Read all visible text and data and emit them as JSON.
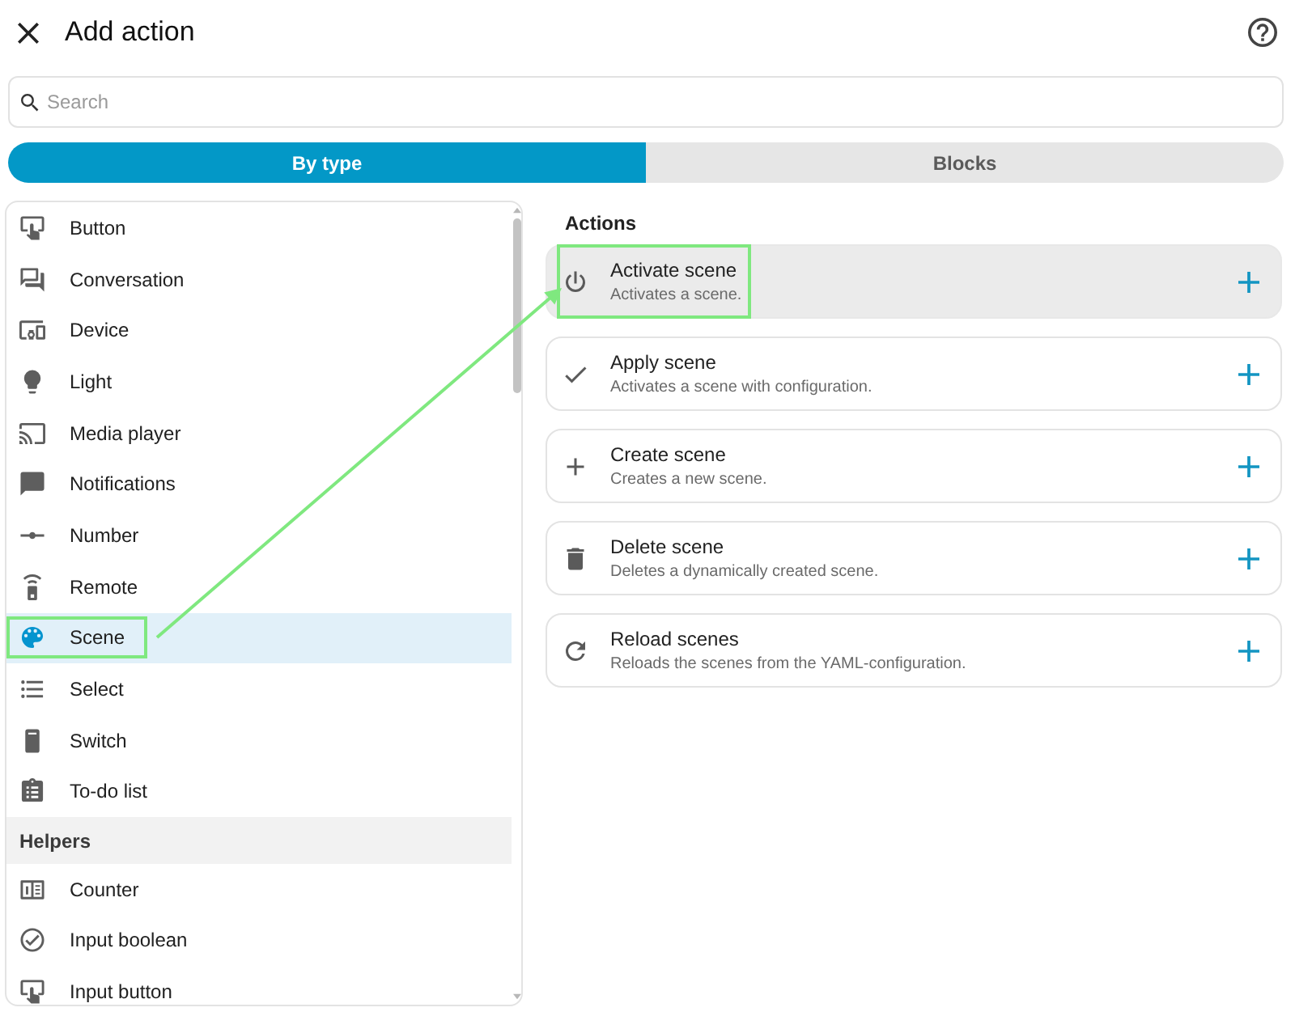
{
  "header": {
    "title": "Add action"
  },
  "search": {
    "placeholder": "Search"
  },
  "tabs": [
    {
      "label": "By type",
      "selected": true
    },
    {
      "label": "Blocks",
      "selected": false
    }
  ],
  "categories": {
    "groups": [
      {
        "items": [
          {
            "label": "Button",
            "selected": false,
            "highlighted": false
          },
          {
            "label": "Conversation",
            "selected": false,
            "highlighted": false
          },
          {
            "label": "Device",
            "selected": false,
            "highlighted": false
          },
          {
            "label": "Light",
            "selected": false,
            "highlighted": false
          },
          {
            "label": "Media player",
            "selected": false,
            "highlighted": false
          },
          {
            "label": "Notifications",
            "selected": false,
            "highlighted": false
          },
          {
            "label": "Number",
            "selected": false,
            "highlighted": false
          },
          {
            "label": "Remote",
            "selected": false,
            "highlighted": false
          },
          {
            "label": "Scene",
            "selected": true,
            "highlighted": true
          },
          {
            "label": "Select",
            "selected": false,
            "highlighted": false
          },
          {
            "label": "Switch",
            "selected": false,
            "highlighted": false
          },
          {
            "label": "To-do list",
            "selected": false,
            "highlighted": false
          }
        ]
      },
      {
        "title": "Helpers",
        "items": [
          {
            "label": "Counter",
            "selected": false,
            "highlighted": false
          },
          {
            "label": "Input boolean",
            "selected": false,
            "highlighted": false
          },
          {
            "label": "Input button",
            "selected": false,
            "highlighted": false
          }
        ]
      }
    ]
  },
  "actions": {
    "title": "Actions",
    "items": [
      {
        "title": "Activate scene",
        "description": "Activates a scene.",
        "selected": true,
        "highlighted": true
      },
      {
        "title": "Apply scene",
        "description": "Activates a scene with configuration.",
        "selected": false,
        "highlighted": false
      },
      {
        "title": "Create scene",
        "description": "Creates a new scene.",
        "selected": false,
        "highlighted": false
      },
      {
        "title": "Delete scene",
        "description": "Deletes a dynamically created scene.",
        "selected": false,
        "highlighted": false
      },
      {
        "title": "Reload scenes",
        "description": "Reloads the scenes from the YAML-configuration.",
        "selected": false,
        "highlighted": false
      }
    ]
  }
}
